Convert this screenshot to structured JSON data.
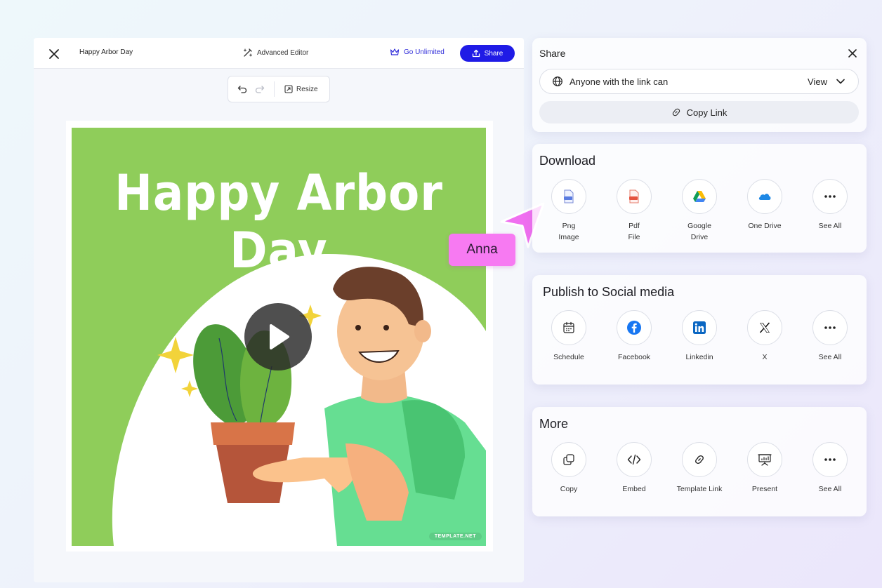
{
  "editor": {
    "doc_title": "Happy Arbor Day",
    "advanced_editor": "Advanced Editor",
    "go_unlimited": "Go Unlimited",
    "share_label": "Share",
    "toolbar": {
      "resize_label": "Resize"
    }
  },
  "poster": {
    "title": "Happy Arbor Day",
    "watermark": "TEMPLATE.NET",
    "colors": {
      "background": "#8fcd5a",
      "shirt": "#64d98f",
      "pot": "#c65e3c"
    }
  },
  "collaborator": {
    "name": "Anna",
    "color": "#f77af2"
  },
  "share_panel": {
    "title": "Share",
    "access_text": "Anyone with the link can",
    "access_value": "View",
    "copy_link_label": "Copy Link"
  },
  "download": {
    "title": "Download",
    "items": [
      {
        "label": "Png\nImage",
        "icon": "png-file-icon"
      },
      {
        "label": "Pdf\nFile",
        "icon": "pdf-file-icon"
      },
      {
        "label": "Google\nDrive",
        "icon": "google-drive-icon"
      },
      {
        "label": "One Drive",
        "icon": "onedrive-icon"
      },
      {
        "label": "See All",
        "icon": "more-dots-icon"
      }
    ]
  },
  "social": {
    "title": "Publish to Social media",
    "items": [
      {
        "label": "Schedule",
        "icon": "calendar-icon"
      },
      {
        "label": "Facebook",
        "icon": "facebook-icon"
      },
      {
        "label": "Linkedin",
        "icon": "linkedin-icon"
      },
      {
        "label": "X",
        "icon": "x-logo-icon"
      },
      {
        "label": "See All",
        "icon": "more-dots-icon"
      }
    ]
  },
  "more": {
    "title": "More",
    "items": [
      {
        "label": "Copy",
        "icon": "copy-icon"
      },
      {
        "label": "Embed",
        "icon": "code-icon"
      },
      {
        "label": "Template Link",
        "icon": "link-icon"
      },
      {
        "label": "Present",
        "icon": "presentation-icon"
      },
      {
        "label": "See All",
        "icon": "more-dots-icon"
      }
    ]
  },
  "accent": "#1f1be6"
}
